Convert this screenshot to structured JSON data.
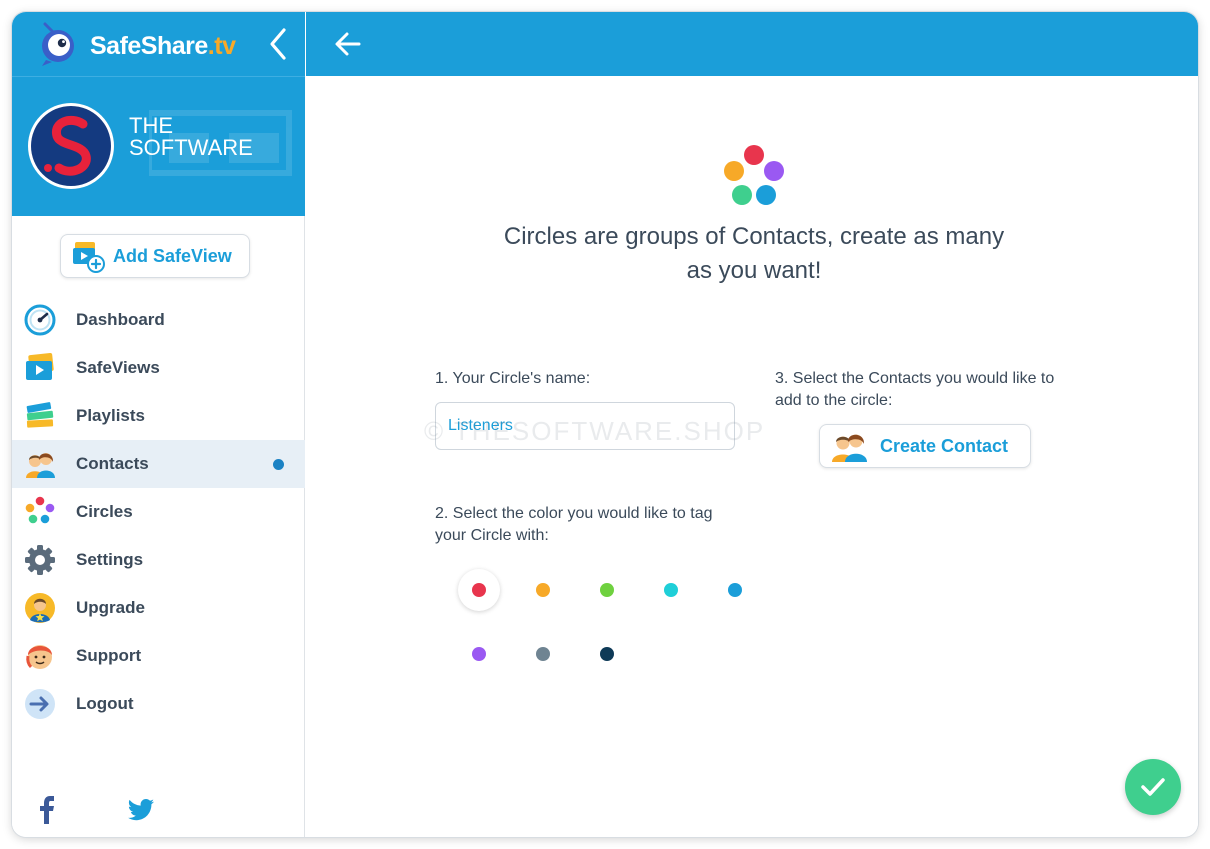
{
  "brand": {
    "name": "SafeShare",
    "tld": ".tv"
  },
  "profile": {
    "name": "THE SOFTWARE"
  },
  "sidebar": {
    "add_button_label": "Add SafeView",
    "items": [
      {
        "label": "Dashboard",
        "icon": "dashboard-icon"
      },
      {
        "label": "SafeViews",
        "icon": "safeviews-icon"
      },
      {
        "label": "Playlists",
        "icon": "playlists-icon"
      },
      {
        "label": "Contacts",
        "icon": "contacts-icon",
        "active": true
      },
      {
        "label": "Circles",
        "icon": "circles-icon"
      },
      {
        "label": "Settings",
        "icon": "gear-icon"
      },
      {
        "label": "Upgrade",
        "icon": "upgrade-icon"
      },
      {
        "label": "Support",
        "icon": "support-icon"
      },
      {
        "label": "Logout",
        "icon": "logout-icon"
      }
    ],
    "social": [
      "facebook-icon",
      "twitter-icon"
    ]
  },
  "main": {
    "headline": "Circles are groups of Contacts, create as many as you want!",
    "name_label": "1. Your Circle's name:",
    "name_value": "Listeners",
    "watermark": "© THESOFTWARE.SHOP",
    "color_label": "2. Select the color you would like to tag your Circle with:",
    "colors": [
      "#e8354d",
      "#f7a928",
      "#6fd13f",
      "#1fcfd8",
      "#1b9ed9",
      "#9a59f2",
      "#6f8492",
      "#0e3a57"
    ],
    "selected_color_index": 0,
    "contacts_label": "3. Select the Contacts you would like to add to the circle:",
    "create_contact_label": "Create Contact"
  },
  "colors": {
    "accent": "#1b9ed9",
    "confirm": "#3fcf8e",
    "text": "#3b4a5a"
  }
}
